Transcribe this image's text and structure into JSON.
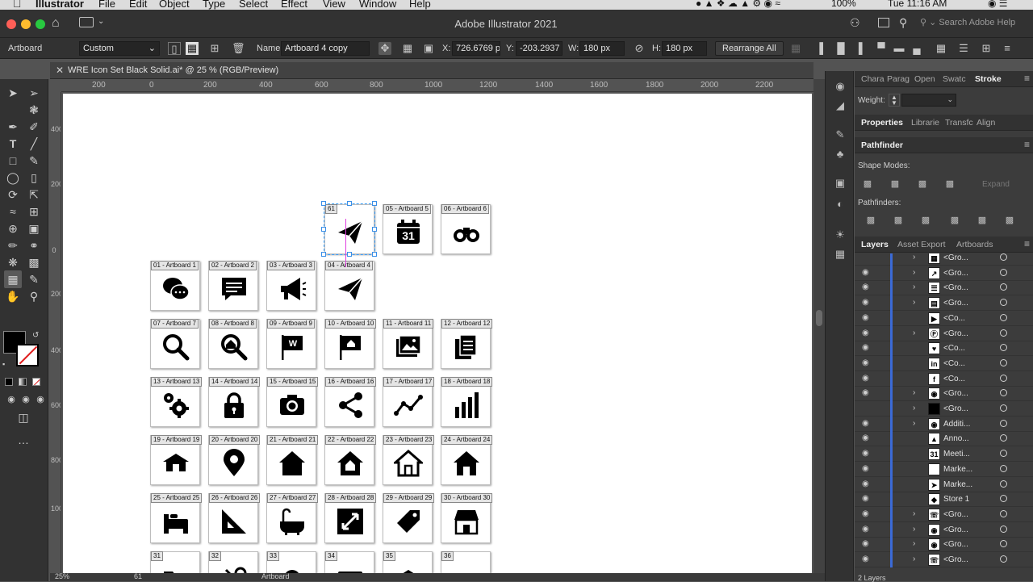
{
  "menubar": {
    "app": "Illustrator",
    "items": [
      "File",
      "Edit",
      "Object",
      "Type",
      "Select",
      "Effect",
      "View",
      "Window",
      "Help"
    ],
    "battery": "100%",
    "clock": "Tue 11:16 AM"
  },
  "titlebar": {
    "title": "Adobe Illustrator 2021",
    "search_placeholder": "Search Adobe Help"
  },
  "controlbar": {
    "context_label": "Artboard",
    "preset": "Custom",
    "name_label": "Name:",
    "name_value": "Artboard 4 copy",
    "x_label": "X:",
    "x_value": "726.6769 p",
    "y_label": "Y:",
    "y_value": "-203.2937 p",
    "w_label": "W:",
    "w_value": "180 px",
    "h_label": "H:",
    "h_value": "180 px",
    "rearrange": "Rearrange All"
  },
  "document": {
    "tab_name": "WRE Icon Set Black Solid.ai* @ 25 % (RGB/Preview)"
  },
  "rulers": {
    "h_ticks": [
      "200",
      "0",
      "200",
      "400",
      "600",
      "800",
      "1000",
      "1200",
      "1400",
      "1600",
      "1800",
      "2000",
      "2200"
    ],
    "v_ticks": [
      "400",
      "200",
      "0",
      "200",
      "400",
      "600",
      "800",
      "1000"
    ]
  },
  "artboards": [
    {
      "label": "61",
      "icon": "paper-plane"
    },
    {
      "label": "05 - Artboard 5",
      "icon": "calendar-31",
      "icon_text": "31"
    },
    {
      "label": "06 - Artboard 6",
      "icon": "binoculars"
    },
    {
      "label": "01 - Artboard 1",
      "icon": "chat-bubbles"
    },
    {
      "label": "02 - Artboard 2",
      "icon": "message"
    },
    {
      "label": "03 - Artboard 3",
      "icon": "megaphone"
    },
    {
      "label": "04 - Artboard 4",
      "icon": "paper-plane"
    },
    {
      "label": "07 - Artboard 7",
      "icon": "search"
    },
    {
      "label": "08 - Artboard 8",
      "icon": "search-home"
    },
    {
      "label": "09 - Artboard 9",
      "icon": "flag-w",
      "icon_text": "W"
    },
    {
      "label": "10 - Artboard 10",
      "icon": "flag-home"
    },
    {
      "label": "11 - Artboard 11",
      "icon": "images"
    },
    {
      "label": "12 - Artboard 12",
      "icon": "documents"
    },
    {
      "label": "13 - Artboard 13",
      "icon": "gears"
    },
    {
      "label": "14 - Artboard 14",
      "icon": "lock"
    },
    {
      "label": "15 - Artboard 15",
      "icon": "camera"
    },
    {
      "label": "16 - Artboard 16",
      "icon": "share"
    },
    {
      "label": "17 - Artboard 17",
      "icon": "line-graph"
    },
    {
      "label": "18 - Artboard 18",
      "icon": "bar-graph"
    },
    {
      "label": "19 - Artboard 19",
      "icon": "house-low"
    },
    {
      "label": "20 - Artboard 20",
      "icon": "map-pin"
    },
    {
      "label": "21 - Artboard 21",
      "icon": "house-solid"
    },
    {
      "label": "22 - Artboard 22",
      "icon": "house-pentagon"
    },
    {
      "label": "23 - Artboard 23",
      "icon": "house-outline"
    },
    {
      "label": "24 - Artboard 24",
      "icon": "house-door"
    },
    {
      "label": "25 - Artboard 25",
      "icon": "bed"
    },
    {
      "label": "26 - Artboard 26",
      "icon": "ruler"
    },
    {
      "label": "27 - Artboard 27",
      "icon": "bathtub"
    },
    {
      "label": "28 - Artboard 28",
      "icon": "expand"
    },
    {
      "label": "29 - Artboard 29",
      "icon": "tag"
    },
    {
      "label": "30 - Artboard 30",
      "icon": "storefront"
    },
    {
      "label": "31",
      "icon": "folder"
    },
    {
      "label": "32",
      "icon": "tools"
    },
    {
      "label": "33",
      "icon": "bell"
    },
    {
      "label": "34",
      "icon": "card"
    },
    {
      "label": "35",
      "icon": "house-low"
    },
    {
      "label": "36",
      "icon": "key"
    }
  ],
  "statusbar": {
    "zoom": "25%",
    "artboard_num": "61",
    "tool_name": "Artboard"
  },
  "panels": {
    "top_tabs": [
      "Chara",
      "Parag",
      "Open",
      "Swatc",
      "Stroke"
    ],
    "weight_label": "Weight:",
    "prop_tabs": [
      "Properties",
      "Librarie",
      "Transfc",
      "Align"
    ],
    "pathfinder_title": "Pathfinder",
    "shape_modes_label": "Shape Modes:",
    "expand_label": "Expand",
    "pathfinders_label": "Pathfinders:",
    "layer_tabs": [
      "Layers",
      "Asset Export",
      "Artboards"
    ],
    "layers": [
      {
        "name": "<Gro...",
        "icon": "grid",
        "twirl": true,
        "eye": false
      },
      {
        "name": "<Gro...",
        "icon": "line-graph",
        "twirl": true,
        "eye": true
      },
      {
        "name": "<Gro...",
        "icon": "list",
        "twirl": true,
        "eye": true
      },
      {
        "name": "<Gro...",
        "icon": "id-card",
        "twirl": true,
        "eye": true
      },
      {
        "name": "<Co...",
        "icon": "youtube",
        "twirl": false,
        "eye": true
      },
      {
        "name": "<Gro...",
        "icon": "pinterest",
        "twirl": true,
        "eye": true
      },
      {
        "name": "<Co...",
        "icon": "heart",
        "twirl": false,
        "eye": true
      },
      {
        "name": "<Co...",
        "icon": "linkedin",
        "twirl": false,
        "eye": true
      },
      {
        "name": "<Co...",
        "icon": "facebook",
        "twirl": false,
        "eye": true
      },
      {
        "name": "<Gro...",
        "icon": "instagram",
        "twirl": true,
        "eye": true
      },
      {
        "name": "<Gro...",
        "icon": "black-square",
        "twirl": true,
        "eye": false
      },
      {
        "name": "Additi...",
        "icon": "map-pin",
        "twirl": true,
        "eye": true
      },
      {
        "name": "Anno...",
        "icon": "megaphone",
        "twirl": false,
        "eye": true
      },
      {
        "name": "Meeti...",
        "icon": "calendar-31",
        "twirl": false,
        "eye": true
      },
      {
        "name": "Marke...",
        "icon": "blank",
        "twirl": false,
        "eye": true
      },
      {
        "name": "Marke...",
        "icon": "paper-plane",
        "twirl": false,
        "eye": true
      },
      {
        "name": "Store 1",
        "icon": "tag",
        "twirl": false,
        "eye": true
      },
      {
        "name": "<Gro...",
        "icon": "phone",
        "twirl": true,
        "eye": true
      },
      {
        "name": "<Gro...",
        "icon": "map-pin",
        "twirl": true,
        "eye": true
      },
      {
        "name": "<Gro...",
        "icon": "camera",
        "twirl": true,
        "eye": true
      },
      {
        "name": "<Gro...",
        "icon": "phone",
        "twirl": true,
        "eye": true
      }
    ],
    "layers_count": "2 Layers"
  },
  "colors": {
    "ui_dark": "#323232",
    "ui_mid": "#535353",
    "selection": "#3aa0ff",
    "layer_color": "#3b6ad6"
  }
}
